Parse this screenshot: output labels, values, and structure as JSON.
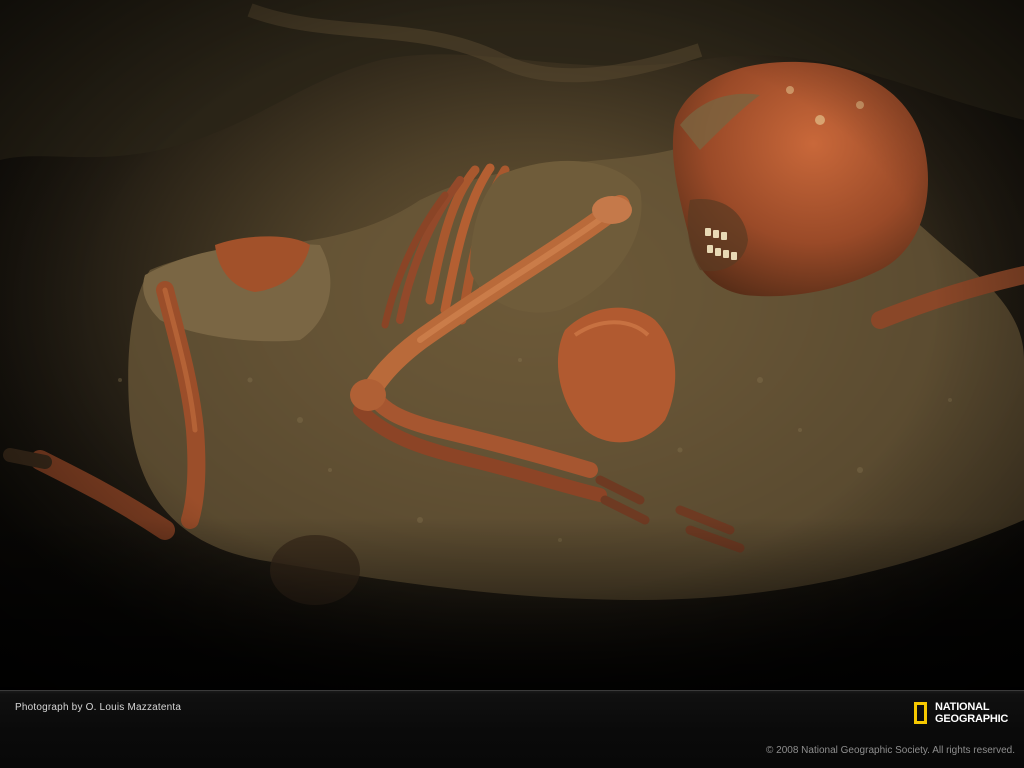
{
  "photo": {
    "subject": "skeleton-in-earth-photo"
  },
  "caption_bar": {
    "credit": "Photograph by O. Louis Mazzatenta",
    "logo": {
      "line1": "NATIONAL",
      "line2": "GEOGRAPHIC",
      "brand_color": "#f6c800"
    },
    "copyright": "© 2008 National Geographic Society. All rights reserved."
  }
}
